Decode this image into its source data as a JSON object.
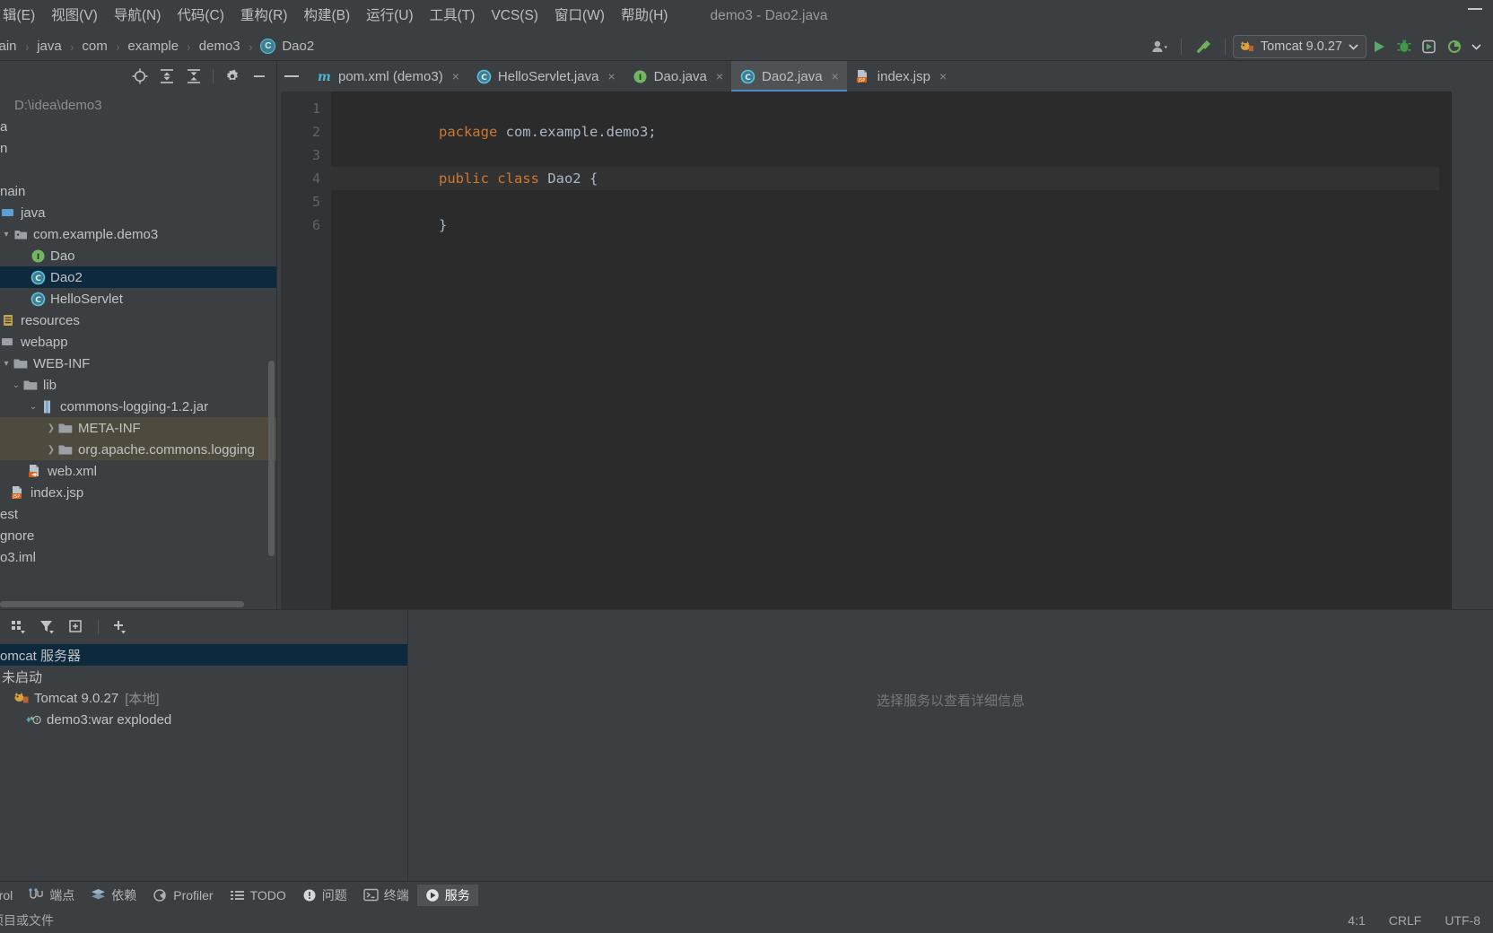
{
  "window": {
    "title": "demo3 - Dao2.java",
    "minimize_icon": "minimize-icon"
  },
  "menubar": {
    "items": [
      {
        "label": "辑(E)"
      },
      {
        "label": "视图(V)"
      },
      {
        "label": "导航(N)"
      },
      {
        "label": "代码(C)"
      },
      {
        "label": "重构(R)"
      },
      {
        "label": "构建(B)"
      },
      {
        "label": "运行(U)"
      },
      {
        "label": "工具(T)"
      },
      {
        "label": "VCS(S)"
      },
      {
        "label": "窗口(W)"
      },
      {
        "label": "帮助(H)"
      }
    ]
  },
  "navbar": {
    "breadcrumbs": [
      {
        "label": "main",
        "icon": ""
      },
      {
        "label": "java",
        "icon": ""
      },
      {
        "label": "com",
        "icon": ""
      },
      {
        "label": "example",
        "icon": ""
      },
      {
        "label": "demo3",
        "icon": ""
      },
      {
        "label": "Dao2",
        "icon": "class-icon"
      }
    ],
    "separator": "›",
    "user_icon": "user-icon",
    "build_icon": "hammer-icon",
    "run_config": {
      "label": "Tomcat 9.0.27",
      "icon": "tomcat-icon",
      "dropdown": "chevron-down-icon"
    },
    "run_icon": "run-icon",
    "debug_icon": "debug-icon",
    "rerun_icon": "rerun-icon",
    "coverage_icon": "coverage-icon",
    "more_icon": "chevron-down-icon"
  },
  "project_panel": {
    "toolbar": [
      {
        "name": "locate-icon"
      },
      {
        "name": "expand-all-icon"
      },
      {
        "name": "collapse-all-icon"
      },
      {
        "name": "settings-gear-icon"
      },
      {
        "name": "hide-icon"
      }
    ],
    "tree": [
      {
        "label": "D:\\idea\\demo3",
        "indent": 0,
        "icon": "",
        "state": "normal",
        "dim": true
      },
      {
        "label": "a",
        "indent": 0,
        "icon": "",
        "state": "normal",
        "dim": false
      },
      {
        "label": "n",
        "indent": 0,
        "icon": "",
        "state": "normal",
        "dim": false
      },
      {
        "label": "",
        "indent": 0,
        "icon": "",
        "state": "normal",
        "dim": false
      },
      {
        "label": "nain",
        "indent": 0,
        "icon": "",
        "state": "normal",
        "dim": false
      },
      {
        "label": "java",
        "indent": 0,
        "icon": "source-root-icon",
        "state": "normal",
        "dim": false
      },
      {
        "label": "com.example.demo3",
        "indent": 0,
        "icon": "package-icon",
        "state": "expanded",
        "dim": false
      },
      {
        "label": "Dao",
        "indent": 1,
        "icon": "interface-icon",
        "state": "normal",
        "dim": false
      },
      {
        "label": "Dao2",
        "indent": 1,
        "icon": "class-icon",
        "state": "selected",
        "dim": false
      },
      {
        "label": "HelloServlet",
        "indent": 1,
        "icon": "class-icon",
        "state": "normal",
        "dim": false
      },
      {
        "label": "resources",
        "indent": 0,
        "icon": "resource-root-icon",
        "state": "normal",
        "dim": false
      },
      {
        "label": "webapp",
        "indent": 0,
        "icon": "webapp-icon",
        "state": "normal",
        "dim": false
      },
      {
        "label": "WEB-INF",
        "indent": 0,
        "icon": "folder-icon",
        "state": "expanded",
        "dim": false
      },
      {
        "label": "lib",
        "indent": 1,
        "icon": "folder-icon",
        "state": "expanded",
        "dim": false
      },
      {
        "label": "commons-logging-1.2.jar",
        "indent": 2,
        "icon": "jar-icon",
        "state": "expanded",
        "dim": false
      },
      {
        "label": "META-INF",
        "indent": 3,
        "icon": "folder-icon",
        "state": "collapsed-highlight",
        "dim": false
      },
      {
        "label": "org.apache.commons.logging",
        "indent": 3,
        "icon": "folder-icon",
        "state": "collapsed-highlight",
        "dim": false
      },
      {
        "label": "web.xml",
        "indent": 2,
        "icon": "xml-icon",
        "state": "normal",
        "dim": false
      },
      {
        "label": "index.jsp",
        "indent": 1,
        "icon": "jsp-icon",
        "state": "normal",
        "dim": false
      },
      {
        "label": "est",
        "indent": 0,
        "icon": "",
        "state": "normal",
        "dim": false
      },
      {
        "label": "gnore",
        "indent": 0,
        "icon": "",
        "state": "normal",
        "dim": false
      },
      {
        "label": "o3.iml",
        "indent": 0,
        "icon": "",
        "state": "normal",
        "dim": false
      }
    ]
  },
  "editor": {
    "tabs": [
      {
        "label": "pom.xml (demo3)",
        "icon": "maven-icon",
        "active": false,
        "close": "×"
      },
      {
        "label": "HelloServlet.java",
        "icon": "class-icon",
        "active": false,
        "close": "×"
      },
      {
        "label": "Dao.java",
        "icon": "interface-icon",
        "active": false,
        "close": "×"
      },
      {
        "label": "Dao2.java",
        "icon": "class-icon",
        "active": true,
        "close": "×"
      },
      {
        "label": "index.jsp",
        "icon": "jsp-icon",
        "active": false,
        "close": "×"
      }
    ],
    "line_numbers": [
      "1",
      "2",
      "3",
      "4",
      "5",
      "6"
    ],
    "current_line": 4,
    "code_lines": [
      {
        "num": 1,
        "tokens": [
          {
            "t": "package ",
            "c": "kw"
          },
          {
            "t": "com.example.demo3;",
            "c": "plain"
          }
        ]
      },
      {
        "num": 2,
        "tokens": [
          {
            "t": "",
            "c": "plain"
          }
        ]
      },
      {
        "num": 3,
        "tokens": [
          {
            "t": "public class ",
            "c": "kw"
          },
          {
            "t": "Dao2 {",
            "c": "plain"
          }
        ]
      },
      {
        "num": 4,
        "tokens": [
          {
            "t": "",
            "c": "plain"
          }
        ]
      },
      {
        "num": 5,
        "tokens": [
          {
            "t": "}",
            "c": "plain"
          }
        ]
      },
      {
        "num": 6,
        "tokens": [
          {
            "t": "",
            "c": "plain"
          }
        ]
      }
    ]
  },
  "services": {
    "toolbar": [
      {
        "name": "group-by-icon"
      },
      {
        "name": "filter-icon"
      },
      {
        "name": "add-frame-icon"
      },
      {
        "name": "add-service-icon"
      }
    ],
    "tree": [
      {
        "label": "omcat 服务器",
        "sub": "",
        "icon": "tomcat-server-icon",
        "state": "selected",
        "indent": 0
      },
      {
        "label": "未启动",
        "sub": "",
        "icon": "",
        "state": "normal",
        "indent": 0
      },
      {
        "label": "Tomcat 9.0.27",
        "sub": "[本地]",
        "icon": "tomcat-icon",
        "state": "normal",
        "indent": 0
      },
      {
        "label": "demo3:war exploded",
        "sub": "",
        "icon": "artifact-icon",
        "state": "normal",
        "indent": 1
      }
    ],
    "placeholder": "选择服务以查看详细信息"
  },
  "toolwindow_bar": {
    "buttons": [
      {
        "label": "ntrol",
        "icon": "version-control-icon",
        "active": false
      },
      {
        "label": "端点",
        "icon": "endpoints-icon",
        "active": false
      },
      {
        "label": "依赖",
        "icon": "dependencies-icon",
        "active": false
      },
      {
        "label": "Profiler",
        "icon": "profiler-icon",
        "active": false
      },
      {
        "label": "TODO",
        "icon": "todo-icon",
        "active": false
      },
      {
        "label": "问题",
        "icon": "problems-icon",
        "active": false
      },
      {
        "label": "终端",
        "icon": "terminal-icon",
        "active": false
      },
      {
        "label": "服务",
        "icon": "services-icon",
        "active": true
      }
    ]
  },
  "statusbar": {
    "left": "项目或文件",
    "caret": "4:1",
    "line_separator": "CRLF",
    "encoding": "UTF-8"
  },
  "colors": {
    "accent_blue": "#4a88c7",
    "selection_blue": "#0d293e",
    "highlight_tan": "#4e4a3e",
    "editor_bg": "#2b2b2b",
    "panel_bg": "#3c3f41",
    "keyword_orange": "#cc7832",
    "run_green": "#499c54"
  }
}
